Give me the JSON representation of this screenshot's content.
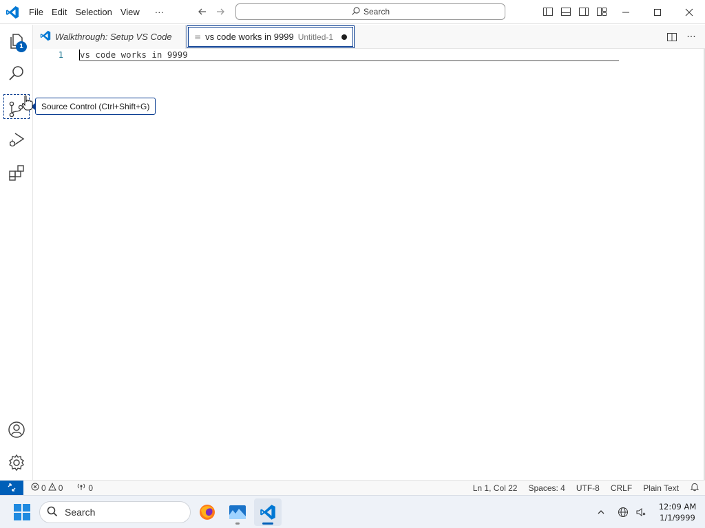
{
  "menu": {
    "items": [
      "File",
      "Edit",
      "Selection",
      "View",
      "···"
    ]
  },
  "command_center": {
    "placeholder": "Search"
  },
  "activity_bar": {
    "explorer_badge": "1"
  },
  "tooltip": {
    "text": "Source Control (Ctrl+Shift+G)"
  },
  "tabs": {
    "walkthrough": "Walkthrough: Setup VS Code",
    "active_label": "vs code works in 9999",
    "active_description": "Untitled-1"
  },
  "editor": {
    "line_number": "1",
    "line_text": "vs code works in 9999"
  },
  "status_bar": {
    "errors": "0",
    "warnings": "0",
    "ports": "0",
    "position": "Ln 1, Col 22",
    "spaces": "Spaces: 4",
    "encoding": "UTF-8",
    "eol": "CRLF",
    "language": "Plain Text"
  },
  "taskbar": {
    "search_placeholder": "Search",
    "time": "12:09 AM",
    "date": "1/1/9999"
  },
  "colors": {
    "accent": "#005fb8",
    "focus_border": "#0a3d91",
    "vscode_blue": "#0078d4"
  }
}
